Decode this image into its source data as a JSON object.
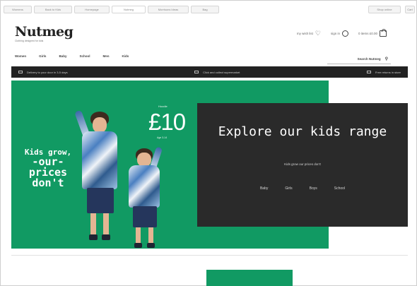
{
  "browser": {
    "tabs": [
      "Womens",
      "Back to Kids",
      "Homepage",
      "Nutmeg",
      "Morrisons Ideas",
      "Bag"
    ],
    "active_tab": 3,
    "right_items": [
      "Shop online",
      "Cart"
    ]
  },
  "header": {
    "logo": "Nutmeg",
    "logo_sub": "Clothing designed for kids",
    "wishlist_label": "my wish list",
    "signin_label": "sign in",
    "basket_label": "0 items £0.00"
  },
  "nav": {
    "items": [
      "Women",
      "Girls",
      "Baby",
      "School",
      "Men",
      "Kids"
    ],
    "search_label": "Search Nutmeg",
    "search_icon": "search-icon"
  },
  "promo": {
    "items": [
      "Delivery to your door in 3-5 days",
      "Click and collect supermarket",
      "Free returns in store"
    ]
  },
  "hero": {
    "tagline": [
      "Kids grow,",
      "-our-",
      "prices",
      "don't"
    ],
    "price_from": "Hoodie",
    "price": "£10",
    "price_age": "Age 3-14",
    "bg_color": "#119a63"
  },
  "panel": {
    "title": "Explore our kids range",
    "subtitle": "Kids grow our prices don't",
    "links": [
      "Baby",
      "Girls",
      "Boys",
      "School"
    ]
  },
  "colors": {
    "brand_green": "#119a63",
    "panel_dark": "#2a2a2a",
    "promo_bar": "#222222"
  }
}
